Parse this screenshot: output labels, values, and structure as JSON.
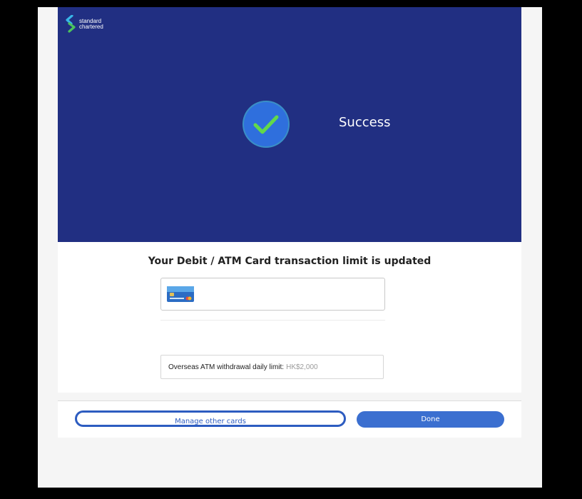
{
  "brand": {
    "line1": "standard",
    "line2": "chartered",
    "logo_icon": "sc-swirl-icon"
  },
  "hero": {
    "status_icon": "check-circle-icon",
    "status_text": "Success"
  },
  "main": {
    "message": "Your Debit / ATM Card transaction limit is updated",
    "card_icon": "credit-card-image",
    "limit_label": "Overseas ATM withdrawal daily limit:",
    "limit_value": "HK$2,000"
  },
  "actions": {
    "manage_label": "Manage other cards",
    "done_label": "Done"
  },
  "colors": {
    "hero_bg": "#212f82",
    "check_circle": "#2f6fdd",
    "check_mark": "#62d94a",
    "button_primary": "#3b6fd0",
    "button_outline": "#2d5cc0"
  }
}
